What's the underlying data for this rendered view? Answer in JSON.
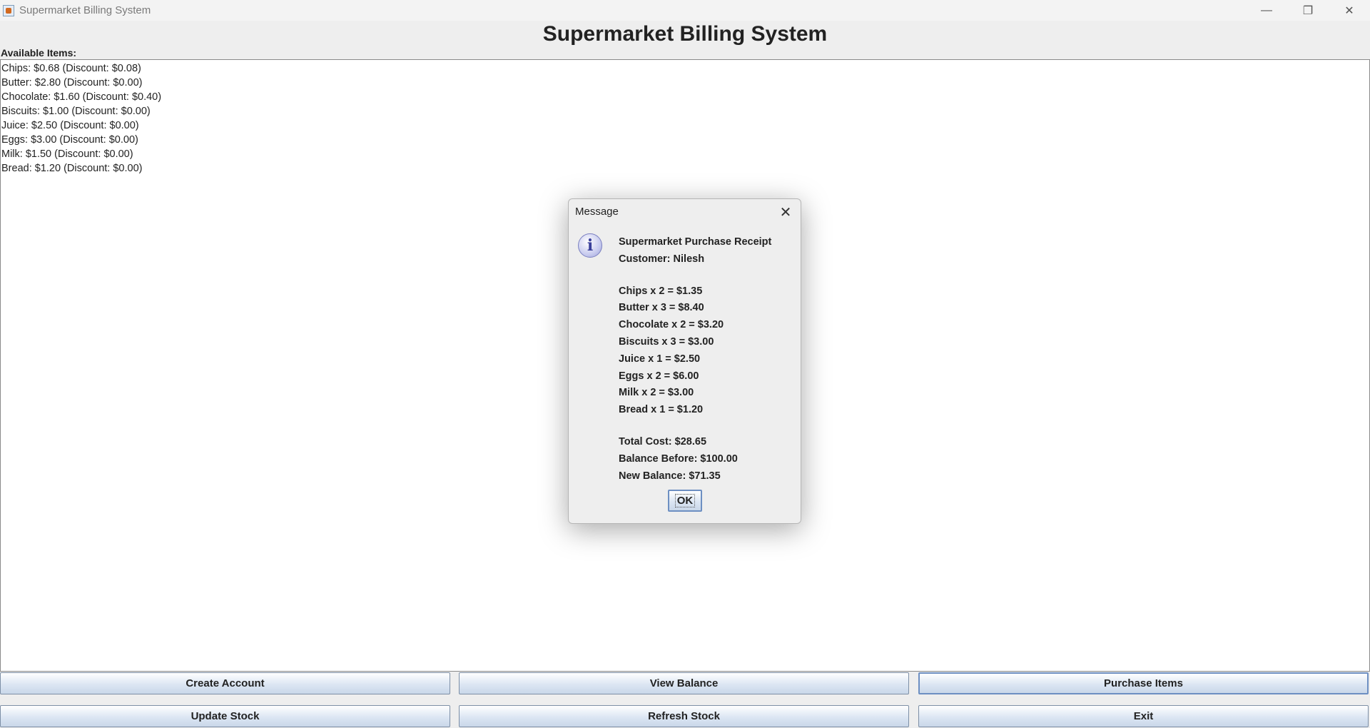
{
  "window": {
    "title": "Supermarket Billing System",
    "minimize_glyph": "—",
    "maximize_glyph": "❐",
    "close_glyph": "✕"
  },
  "app": {
    "heading": "Supermarket Billing System",
    "available_label": "Available Items:"
  },
  "items": [
    "Chips: $0.68 (Discount: $0.08)",
    "Butter: $2.80 (Discount: $0.00)",
    "Chocolate: $1.60 (Discount: $0.40)",
    "Biscuits: $1.00 (Discount: $0.00)",
    "Juice: $2.50 (Discount: $0.00)",
    "Eggs: $3.00 (Discount: $0.00)",
    "Milk: $1.50 (Discount: $0.00)",
    "Bread: $1.20 (Discount: $0.00)"
  ],
  "buttons": {
    "create_account": "Create Account",
    "view_balance": "View Balance",
    "purchase_items": "Purchase Items",
    "update_stock": "Update Stock",
    "refresh_stock": "Refresh Stock",
    "exit": "Exit"
  },
  "dialog": {
    "title": "Message",
    "close_glyph": "✕",
    "icon_glyph": "i",
    "receipt_title": "Supermarket Purchase Receipt",
    "customer": "Customer: Nilesh",
    "lines": [
      "Chips x 2 = $1.35",
      "Butter x 3 = $8.40",
      "Chocolate x 2 = $3.20",
      "Biscuits x 3 = $3.00",
      "Juice x 1 = $2.50",
      "Eggs x 2 = $6.00",
      "Milk x 2 = $3.00",
      "Bread x 1 = $1.20"
    ],
    "total_cost": "Total Cost: $28.65",
    "balance_before": "Balance Before: $100.00",
    "new_balance": "New Balance: $71.35",
    "ok_label": "OK"
  }
}
